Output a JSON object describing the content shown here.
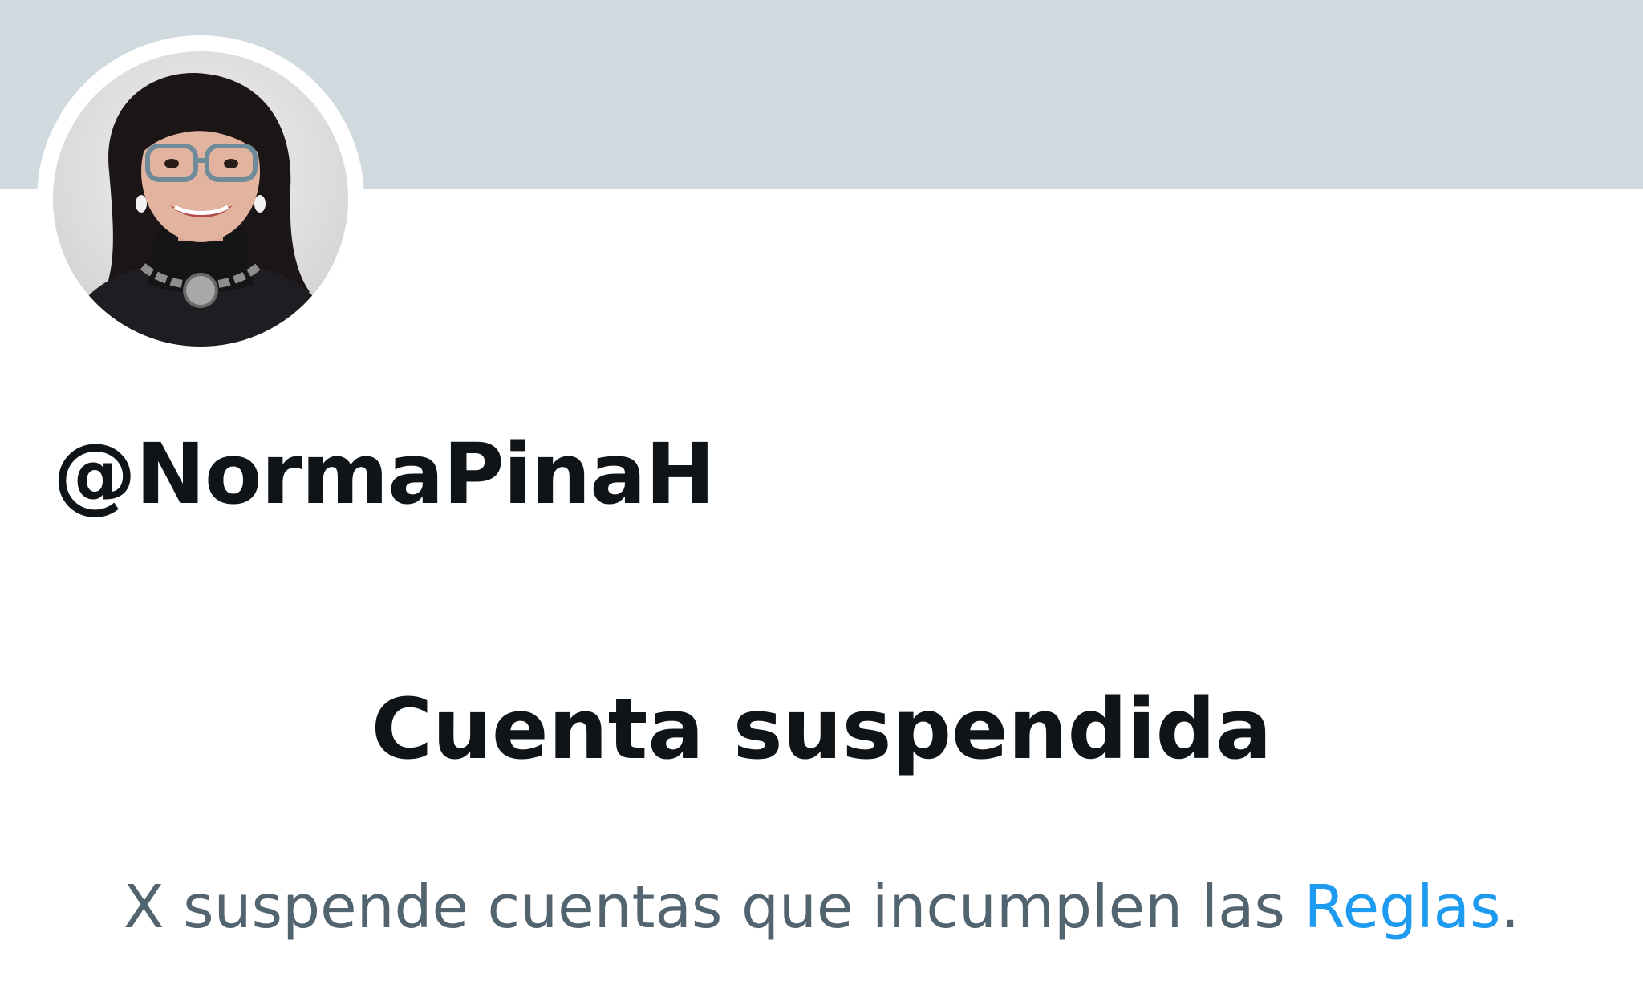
{
  "profile": {
    "handle": "@NormaPinaH",
    "avatar_icon": "profile-photo",
    "banner_color": "#cfd9de"
  },
  "suspension": {
    "title": "Cuenta suspendida",
    "message_prefix": "X suspende cuentas que incumplen las ",
    "rules_link": "Reglas",
    "message_suffix": "."
  },
  "colors": {
    "text_primary": "#0f1419",
    "text_secondary": "#536471",
    "link": "#1d9bf0"
  }
}
